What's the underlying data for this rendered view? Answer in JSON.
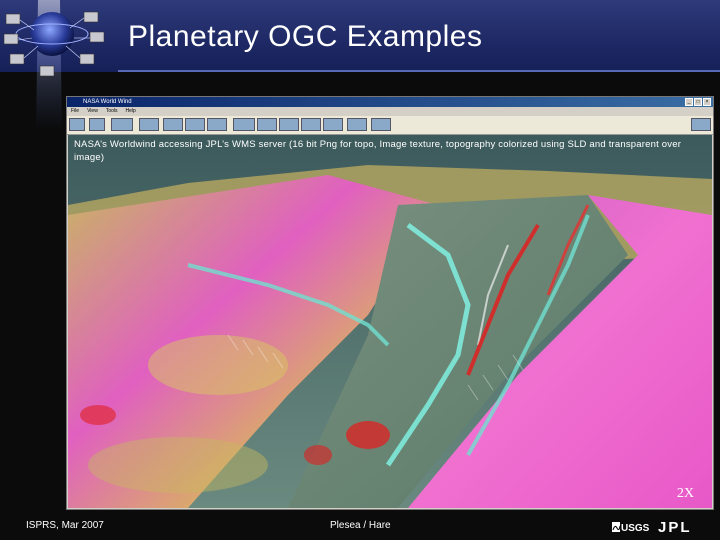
{
  "slide": {
    "title": "Planetary OGC Examples"
  },
  "window": {
    "title": "NASA World Wind",
    "menus": [
      "File",
      "View",
      "Tools",
      "Help"
    ]
  },
  "viewport": {
    "caption": "NASA’s Worldwind accessing JPL’s WMS server (16 bit Png for topo, Image texture, topography colorized using SLD and transparent over image)",
    "zoom_label": "2X"
  },
  "footer": {
    "left": "ISPRS, Mar 2007",
    "center": "Plesea / Hare"
  },
  "colors": {
    "header": "#1f2a66",
    "terrain_magenta": "#e040c8",
    "terrain_yellow": "#d8c860",
    "terrain_red": "#e02020",
    "terrain_cyan": "#70e0d0"
  }
}
